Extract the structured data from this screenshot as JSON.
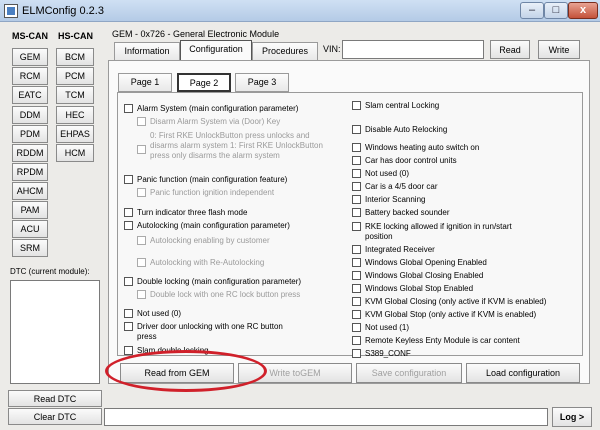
{
  "window": {
    "title": "ELMConfig 0.2.3",
    "min": "–",
    "max": "□",
    "close": "x"
  },
  "left": {
    "ms_can_label": "MS-CAN",
    "hs_can_label": "HS-CAN",
    "ms_modules": [
      "GEM",
      "RCM",
      "EATC",
      "DDM",
      "PDM",
      "RDDM",
      "RPDM",
      "AHCM",
      "PAM",
      "ACU",
      "SRM"
    ],
    "hs_modules": [
      "BCM",
      "PCM",
      "TCM",
      "HEC",
      "EHPAS",
      "HCM"
    ],
    "dtc_label": "DTC (current module):",
    "read_dtc": "Read DTC",
    "clear_dtc": "Clear DTC"
  },
  "module": {
    "header": "GEM - 0x726 - General Electronic Module",
    "tabs": [
      "Information",
      "Configuration",
      "Procedures"
    ],
    "vin_label": "VIN:",
    "vin_value": "",
    "read": "Read",
    "write": "Write"
  },
  "pages": [
    "Page 1",
    "Page 2",
    "Page 3"
  ],
  "left_options": [
    "Alarm System (main configuration parameter)",
    "Disarm Alarm System via (Door) Key",
    "0: First RKE UnlockButton press unlocks and disarms alarm system      1: First RKE UnlockButton press only disarms the alarm system",
    "Panic function (main configuration feature)",
    "Panic function ignition independent",
    "Turn indicator three flash mode",
    "Autolocking (main configuration parameter)",
    "Autolocking enabling by customer",
    "Autolocking with Re-Autolocking",
    "Double locking (main configuration parameter)",
    "Double lock with one RC lock button press",
    "Not used (0)",
    "Driver door unlocking with one RC button press",
    "Slam double locking"
  ],
  "right_options": [
    "Slam central Locking",
    "Disable Auto Relocking",
    "Windows heating auto switch on",
    "Car has door control units",
    "Not used (0)",
    "Car is a 4/5 door car",
    "Interior Scanning",
    "Battery backed sounder",
    "RKE locking allowed if ignition in run/start position",
    "Integrated Receiver",
    "Windows Global Opening Enabled",
    "Windows Global Closing Enabled",
    "Windows Global Stop Enabled",
    "KVM Global Closing (only active if KVM is enabled)",
    "KVM Global Stop (only active if KVM is enabled)",
    "Not used (1)",
    "Remote Keyless Enty Module is car content",
    "S389_CONF"
  ],
  "actions": {
    "read_from_gem": "Read from GEM",
    "write_to_gem": "Write toGEM",
    "save_configuration": "Save configuration",
    "load_configuration": "Load configuration"
  },
  "bottom": {
    "log_value": "",
    "log_button": "Log >"
  },
  "colors": {
    "highlight_ring": "#d0202a"
  }
}
